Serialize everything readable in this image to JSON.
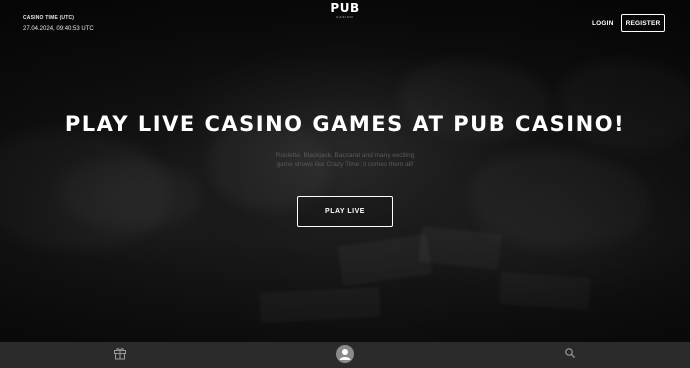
{
  "header": {
    "casino_time_label": "CASINO TIME (UTC)",
    "casino_time_value": "27.04.2024, 09:40:53 UTC",
    "logo_main": "PUB",
    "logo_sub": "CASINO",
    "login_label": "LOGIN",
    "register_label": "REGISTER"
  },
  "hero": {
    "title": "PLAY LIVE CASINO GAMES AT PUB CASINO!",
    "description": "Roulette, Blackjack, Baccarat and many exciting game shows like Crazy Time: it comes them all!",
    "cta_label": "PLAY LIVE"
  },
  "bottom_nav": {
    "items": [
      {
        "icon": "gift-icon"
      },
      {
        "icon": "user-icon"
      },
      {
        "icon": "search-icon"
      }
    ]
  },
  "colors": {
    "background": "#111111",
    "nav_background": "#2b2b2b",
    "text": "#ffffff",
    "muted_text": "#5a5a5a",
    "avatar": "#8a8a8a"
  }
}
